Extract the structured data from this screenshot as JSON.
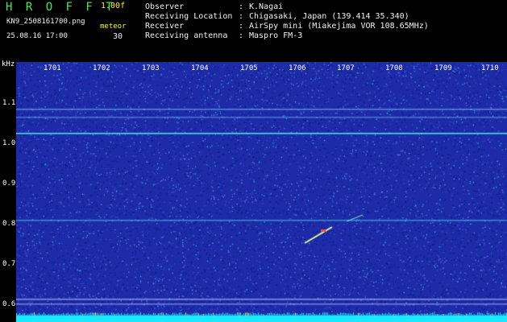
{
  "header": {
    "app_name": "H R O F F T",
    "version": "1.00f",
    "filename": "KN9_2508161700.png",
    "meteor_label": "meteor",
    "datetime": "25.08.16 17:00",
    "meteor_count": "30"
  },
  "info": [
    {
      "label": "Observer",
      "value": "K.Nagai"
    },
    {
      "label": "Receiving Location",
      "value": "Chigasaki, Japan (139.414 35.340)"
    },
    {
      "label": "Receiver",
      "value": "AirSpy mini (Miakejima VOR 108.65MHz)"
    },
    {
      "label": "Receiving antenna",
      "value": "Maspro FM-3"
    }
  ],
  "axes": {
    "y_unit": "kHz",
    "y_ticks": [
      "1.1",
      "1.0",
      "0.9",
      "0.8",
      "0.7",
      "0.6"
    ],
    "x_ticks": [
      "1701",
      "1702",
      "1703",
      "1704",
      "1705",
      "1706",
      "1707",
      "1708",
      "1709",
      "1710"
    ]
  },
  "colors": {
    "background": "#000000",
    "spectrogram": "#1e2ba8",
    "header_green": "#3cf04a",
    "header_white": "#f0f0f0",
    "header_yellow": "#ffef3a",
    "axis_tick": "#ffffff"
  }
}
